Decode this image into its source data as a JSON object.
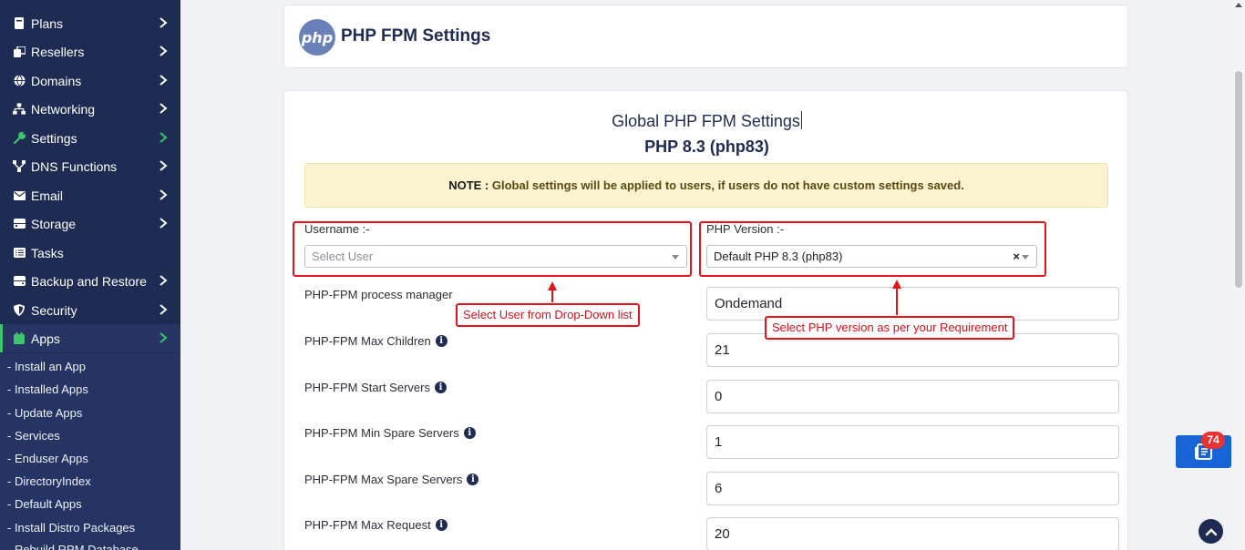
{
  "sidebar": {
    "items": [
      {
        "label": "Plans",
        "icon": "plans-icon"
      },
      {
        "label": "Resellers",
        "icon": "resellers-icon"
      },
      {
        "label": "Domains",
        "icon": "globe-icon"
      },
      {
        "label": "Networking",
        "icon": "network-icon"
      },
      {
        "label": "Settings",
        "icon": "wrench-icon"
      },
      {
        "label": "DNS Functions",
        "icon": "dns-icon"
      },
      {
        "label": "Email",
        "icon": "envelope-icon"
      },
      {
        "label": "Storage",
        "icon": "storage-icon"
      },
      {
        "label": "Tasks",
        "icon": "tasks-icon"
      },
      {
        "label": "Backup and Restore",
        "icon": "backup-icon"
      },
      {
        "label": "Security",
        "icon": "shield-icon"
      },
      {
        "label": "Apps",
        "icon": "apps-icon"
      }
    ],
    "submenu": [
      "- Install an App",
      "- Installed Apps",
      "- Update Apps",
      "- Services",
      "- Enduser Apps",
      "- DirectoryIndex",
      "- Default Apps",
      "- Install Distro Packages",
      "- Rebuild RPM Database"
    ],
    "accent_color": "#3ec46d",
    "background_color": "#1e2b52"
  },
  "header": {
    "logo_text": "php",
    "title": "PHP FPM Settings"
  },
  "main": {
    "global_title": "Global PHP FPM Settings",
    "version_title": "PHP 8.3 (php83)",
    "note_prefix": "NOTE :",
    "note_text": " Global settings will be applied to users, if users do not have custom settings saved.",
    "username_label": "Username :-",
    "username_placeholder": "Select User",
    "php_version_label": "PHP Version :-",
    "php_version_value": "Default PHP 8.3 (php83)",
    "php_version_clear": "×",
    "fields": [
      {
        "label": "PHP-FPM process manager",
        "value": "Ondemand",
        "info": false
      },
      {
        "label": "PHP-FPM Max Children",
        "value": "21",
        "info": true
      },
      {
        "label": "PHP-FPM Start Servers",
        "value": "0",
        "info": true
      },
      {
        "label": "PHP-FPM Min Spare Servers",
        "value": "1",
        "info": true
      },
      {
        "label": "PHP-FPM Max Spare Servers",
        "value": "6",
        "info": true
      },
      {
        "label": "PHP-FPM Max Request",
        "value": "20",
        "info": true
      }
    ]
  },
  "annotations": {
    "user_note": "Select User from Drop-Down list",
    "version_note": "Select PHP version as per your Requirement",
    "color": "#e3141b"
  },
  "widgets": {
    "notification_count": "74"
  }
}
